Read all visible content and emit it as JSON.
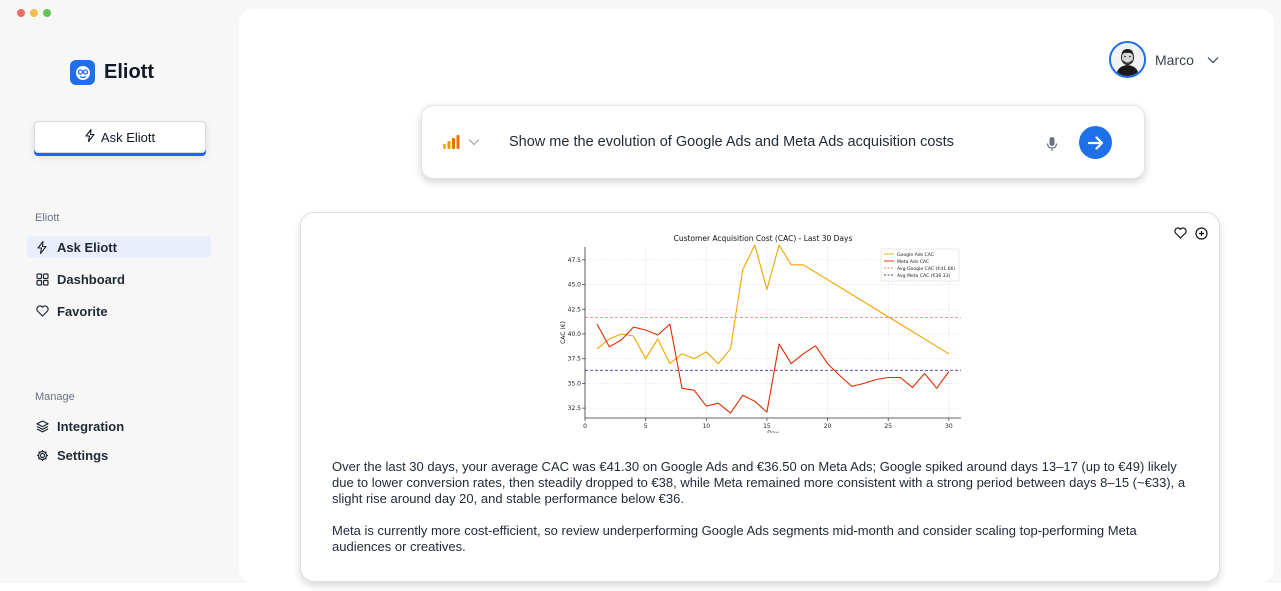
{
  "window": {
    "dots": [
      "#ee6a5f",
      "#f5bd4f",
      "#61c454"
    ]
  },
  "sidebar": {
    "brand": "Eliott",
    "ask_button": "Ask Eliott",
    "section1_title": "Eliott",
    "nav": [
      {
        "label": "Ask Eliott",
        "icon": "bolt-icon",
        "active": true
      },
      {
        "label": "Dashboard",
        "icon": "grid-icon",
        "active": false
      },
      {
        "label": "Favorite",
        "icon": "heart-icon",
        "active": false
      }
    ],
    "section2_title": "Manage",
    "manage": [
      {
        "label": "Integration",
        "icon": "layers-icon"
      },
      {
        "label": "Settings",
        "icon": "gear-icon"
      }
    ]
  },
  "header": {
    "user_name": "Marco"
  },
  "prompt": {
    "source_icon": "analytics-bars-icon",
    "text": "Show me the evolution of Google Ads and Meta Ads acquisition costs"
  },
  "result": {
    "summary_p1": "Over the last 30 days, your average CAC was €41.30 on Google Ads and €36.50 on Meta Ads; Google spiked around days 13–17 (up to €49) likely due to lower conversion rates, then steadily dropped to €38, while Meta remained more consistent with a strong period between days 8–15 (~€33), a slight rise around day 20, and stable performance below €36.",
    "summary_p2": "Meta is currently more cost-efficient, so review underperforming Google Ads segments mid-month and consider scaling top-performing Meta audiences or creatives."
  },
  "chart_data": {
    "type": "line",
    "title": "Customer Acquisition Cost (CAC) - Last 30 Days",
    "xlabel": "Day",
    "ylabel": "CAC (€)",
    "xlim": [
      0,
      31
    ],
    "ylim": [
      31.5,
      48.8
    ],
    "xticks": [
      0,
      5,
      10,
      15,
      20,
      25,
      30
    ],
    "yticks": [
      32.5,
      35.0,
      37.5,
      40.0,
      42.5,
      45.0,
      47.5
    ],
    "grid": true,
    "legend_position": "top-right",
    "series": [
      {
        "name": "Google Ads CAC",
        "color": "#f0a500",
        "style": "solid",
        "x": [
          1,
          2,
          3,
          4,
          5,
          6,
          7,
          8,
          9,
          10,
          11,
          12,
          13,
          14,
          15,
          16,
          17,
          18,
          30
        ],
        "y": [
          38.5,
          39.5,
          40.0,
          39.8,
          37.5,
          39.5,
          37.0,
          38.0,
          37.5,
          38.2,
          37.0,
          38.5,
          46.5,
          49.0,
          44.5,
          49.0,
          47.0,
          47.0,
          38.0
        ]
      },
      {
        "name": "Meta Ads CAC",
        "color": "#dd2c00",
        "style": "solid",
        "x": [
          1,
          2,
          3,
          4,
          5,
          6,
          7,
          8,
          9,
          10,
          11,
          12,
          13,
          14,
          15,
          16,
          17,
          18,
          19,
          20,
          21,
          22,
          23,
          24,
          25,
          26,
          27,
          28,
          29,
          30
        ],
        "y": [
          41.0,
          38.7,
          39.4,
          40.7,
          40.4,
          39.9,
          41.0,
          34.5,
          34.3,
          32.7,
          33.0,
          32.0,
          33.8,
          33.2,
          32.1,
          39.0,
          37.0,
          38.0,
          38.8,
          37.0,
          35.8,
          34.7,
          35.0,
          35.4,
          35.6,
          35.6,
          34.6,
          36.0,
          34.5,
          36.2
        ]
      },
      {
        "name": "Avg Google CAC (€41.66)",
        "color": "#f0766e",
        "style": "dashed",
        "x": [
          0,
          31
        ],
        "y": [
          41.66,
          41.66
        ]
      },
      {
        "name": "Avg Meta CAC (€36.33)",
        "color": "#3b3bb8",
        "style": "dashed",
        "x": [
          0,
          31
        ],
        "y": [
          36.33,
          36.33
        ]
      }
    ]
  }
}
